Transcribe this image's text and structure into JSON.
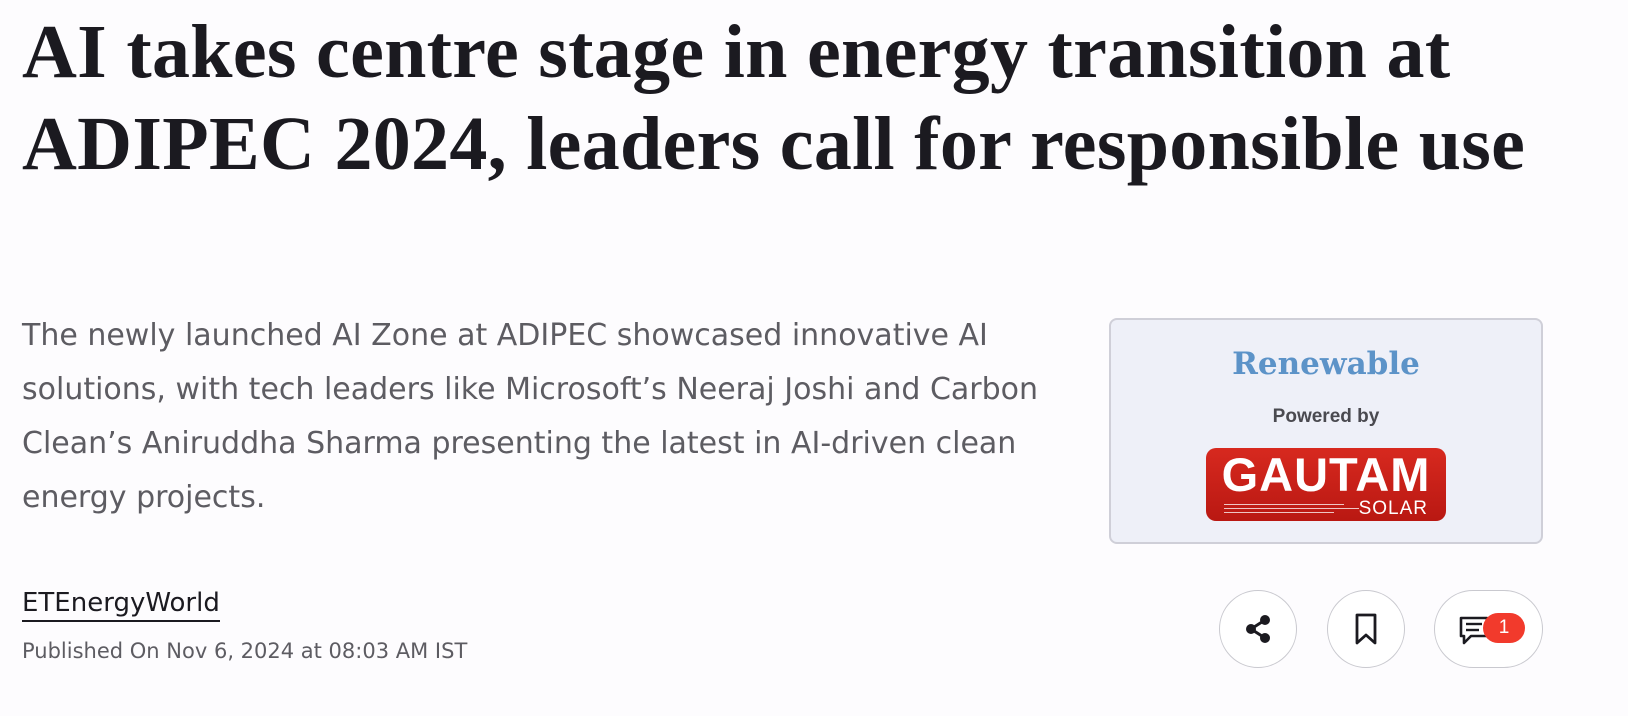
{
  "article": {
    "headline": "AI takes centre stage in energy transition at ADIPEC 2024, leaders call for responsible use",
    "summary": "The newly launched AI Zone at ADIPEC showcased innovative AI solutions, with tech leaders like Microsoft’s Neeraj Joshi and Carbon Clean’s Aniruddha Sharma presenting the latest in AI-driven clean energy projects.",
    "source": "ETEnergyWorld",
    "published": "Published On Nov 6, 2024 at 08:03 AM IST"
  },
  "sponsor": {
    "category": "Renewable",
    "powered_by": "Powered by",
    "logo_word": "GAUTAM",
    "logo_sub": "SOLAR",
    "category_color": "#5c93c8",
    "logo_color": "#c81f17"
  },
  "actions": {
    "share_icon": "share-icon",
    "bookmark_icon": "bookmark-icon",
    "comment_icon": "comment-icon",
    "comment_count": "1",
    "badge_color": "#f23a2c"
  }
}
